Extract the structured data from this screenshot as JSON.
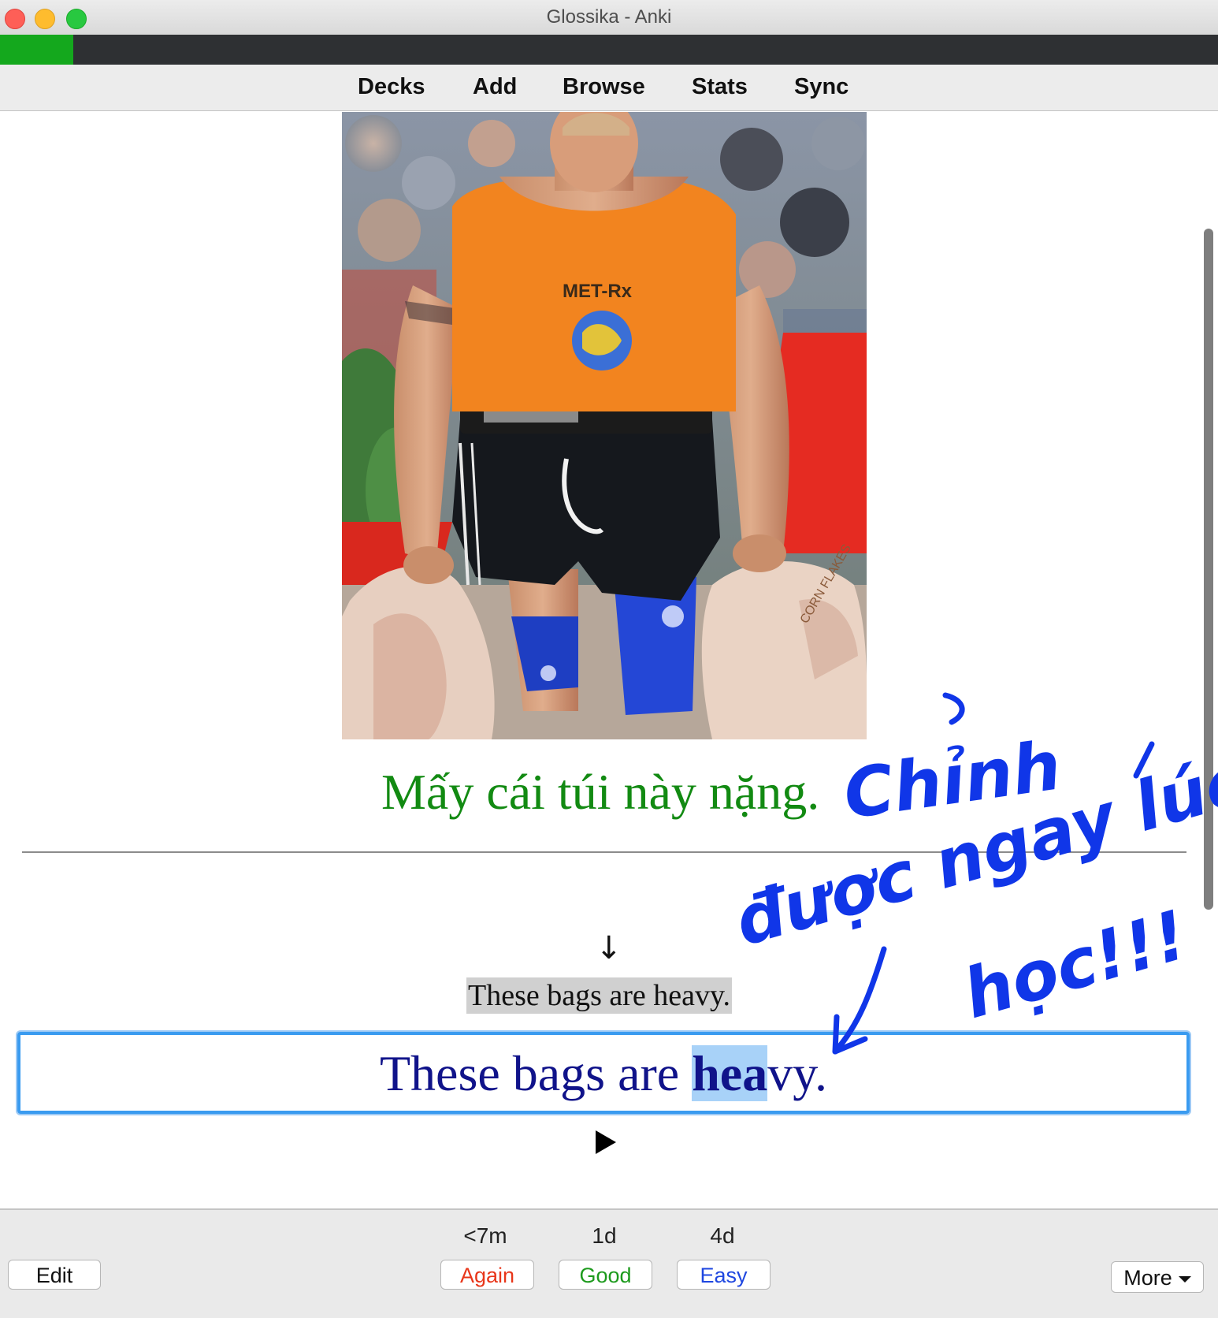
{
  "window": {
    "title": "Glossika - Anki"
  },
  "study_progress": {
    "fraction": 0.06
  },
  "toolbar": {
    "items": [
      "Decks",
      "Add",
      "Browse",
      "Stats",
      "Sync"
    ]
  },
  "card": {
    "image": {
      "shirt_brand": "MET-Rx",
      "bag_label": "CORN FLAKES"
    },
    "vietnamese_sentence": "Mấy cái túi này nặng.",
    "arrow_glyph": "↓",
    "expected_answer": "These bags are heavy.",
    "typed_answer": {
      "before": "These bags are ",
      "highlighted": "hea",
      "after": "vy."
    }
  },
  "annotation": {
    "lines": [
      "Chỉnh",
      "được ngay lúc",
      "học!!!"
    ],
    "color": "#1036e8"
  },
  "bottom_bar": {
    "edit_label": "Edit",
    "more_label": "More",
    "answers": [
      {
        "interval": "<7m",
        "label": "Again",
        "color": "#e8361a"
      },
      {
        "interval": "1d",
        "label": "Good",
        "color": "#1d9a1d"
      },
      {
        "interval": "4d",
        "label": "Easy",
        "color": "#1f47e0"
      }
    ]
  }
}
